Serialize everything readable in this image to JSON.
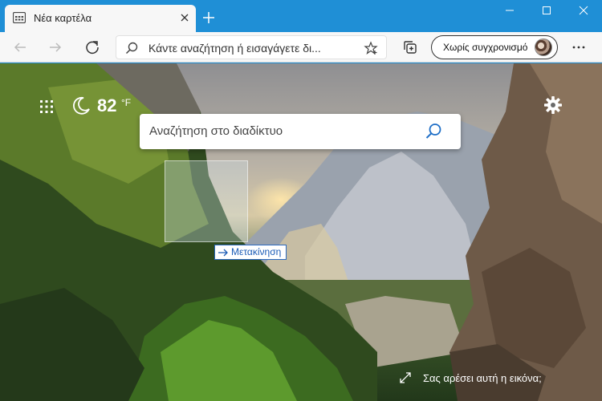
{
  "tab": {
    "title": "Νέα καρτέλα",
    "favicon": "newtab-page-icon",
    "close_icon": "close-icon"
  },
  "new_tab_icon": "plus-icon",
  "window_controls": {
    "minimize": "minimize-icon",
    "maximize": "maximize-icon",
    "close": "close-icon"
  },
  "toolbar": {
    "back_icon": "back-arrow-icon",
    "forward_icon": "forward-arrow-icon",
    "refresh_icon": "refresh-icon",
    "address_placeholder": "Κάντε αναζήτηση ή εισαγάγετε δι...",
    "favorite_icon": "star-icon",
    "collections_icon": "collections-icon",
    "sync_label": "Χωρίς συγχρονισμό",
    "menu_icon": "more-dots-icon"
  },
  "newtab": {
    "apps_icon": "app-launcher-icon",
    "weather_icon": "moon-icon",
    "temperature": "82",
    "temp_unit": "°F",
    "settings_icon": "gear-icon",
    "search_placeholder": "Αναζήτηση στο διαδίκτυο",
    "search_icon": "search-icon",
    "move_tooltip": "Μετακίνηση",
    "expand_icon": "expand-icon",
    "like_image_text": "Σας αρέσει αυτή η εικόνα;"
  },
  "colors": {
    "titlebar": "#1f8fd6",
    "toolbar": "#f7f7f7",
    "link_blue": "#1a5bb5",
    "search_accent": "#1f6fc7"
  }
}
